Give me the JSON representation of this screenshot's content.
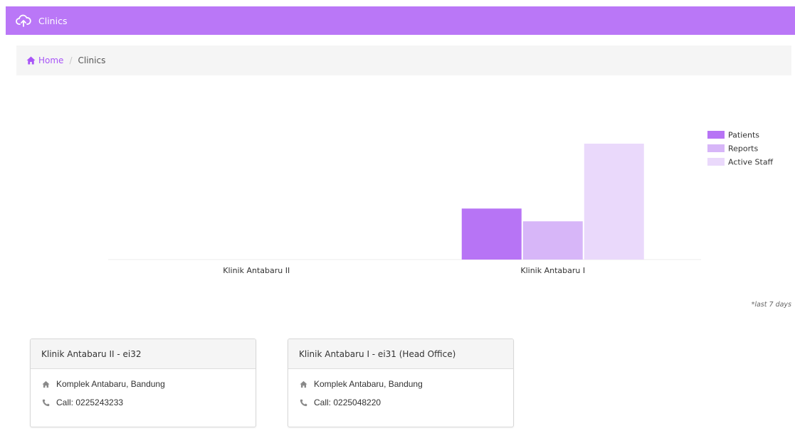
{
  "app": {
    "title": "Clinics",
    "brand_color": "#ba77f7",
    "logo_icon": "cloud-upload-icon"
  },
  "breadcrumb": {
    "home_label": "Home",
    "separator": "/",
    "current": "Clinics"
  },
  "chart_data": {
    "type": "bar",
    "categories": [
      "Klinik Antabaru II",
      "Klinik Antabaru I"
    ],
    "series": [
      {
        "name": "Patients",
        "color": "#b774f5",
        "values": [
          0,
          44
        ]
      },
      {
        "name": "Reports",
        "color": "#d7b6f8",
        "values": [
          0,
          33
        ]
      },
      {
        "name": "Active Staff",
        "color": "#ead9fb",
        "values": [
          0,
          100
        ]
      }
    ],
    "ylim": [
      0,
      100
    ],
    "legend": "top-right",
    "grid": false
  },
  "footnote": "*last 7 days",
  "clinics": [
    {
      "name": "Klinik Antabaru II - ei32",
      "address": "Komplek Antabaru, Bandung",
      "phone": "Call: 0225243233"
    },
    {
      "name": "Klinik Antabaru I - ei31 (Head Office)",
      "address": "Komplek Antabaru, Bandung",
      "phone": "Call: 0225048220"
    }
  ]
}
